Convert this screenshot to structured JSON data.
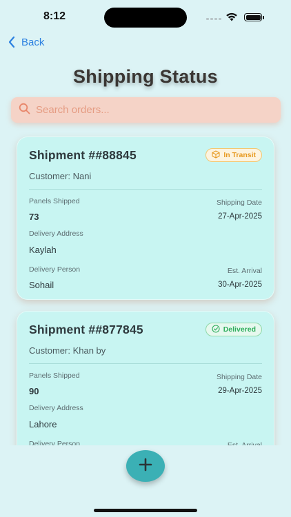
{
  "status_bar": {
    "time": "8:12"
  },
  "nav": {
    "back_label": "Back"
  },
  "page": {
    "title": "Shipping Status"
  },
  "search": {
    "placeholder": "Search orders..."
  },
  "labels": {
    "panels_shipped": "Panels Shipped",
    "shipping_date": "Shipping Date",
    "delivery_address": "Delivery Address",
    "delivery_person": "Delivery Person",
    "est_arrival": "Est. Arrival"
  },
  "shipments": [
    {
      "title": "Shipment ##88845",
      "status": "In Transit",
      "customer": "Customer: Nani",
      "panels_shipped": "73",
      "shipping_date": "27-Apr-2025",
      "delivery_address": "Kaylah",
      "delivery_person": "Sohail",
      "est_arrival": "30-Apr-2025"
    },
    {
      "title": "Shipment ##877845",
      "status": "Delivered",
      "customer": "Customer: Khan by",
      "panels_shipped": "90",
      "shipping_date": "29-Apr-2025",
      "delivery_address": "Lahore"
    }
  ],
  "colors": {
    "background": "#dcf3f5",
    "card": "#c8f5f2",
    "search_bg": "#f5d3c7",
    "accent_blue": "#2a7fe0",
    "fab": "#3bb0b5",
    "transit": "#e79a22",
    "delivered": "#2fae5c"
  },
  "icons": {
    "search": "search-icon",
    "back": "chevron-left-icon",
    "transit": "package-icon",
    "delivered": "check-circle-icon",
    "fab": "plus-icon"
  }
}
